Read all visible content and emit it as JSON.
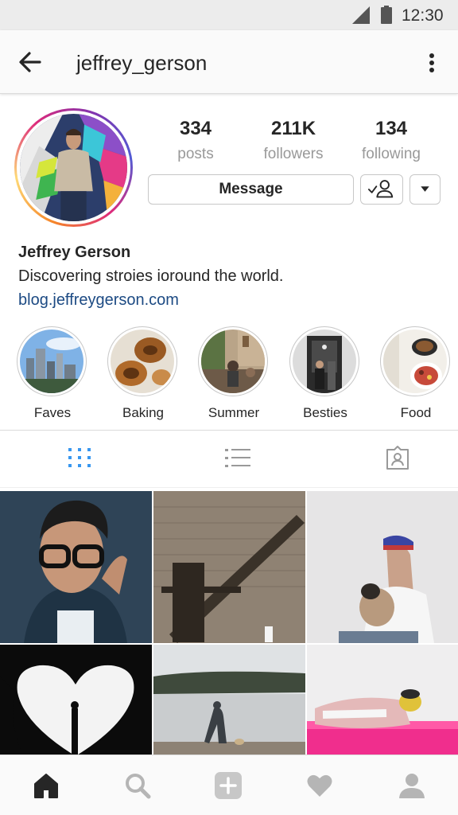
{
  "status_bar": {
    "time": "12:30",
    "icons": [
      "signal-icon",
      "battery-icon"
    ]
  },
  "header": {
    "username": "jeffrey_gerson",
    "back_icon": "arrow-left-icon",
    "menu_icon": "more-vertical-icon"
  },
  "profile": {
    "avatar_ring_colors": [
      "#f58529",
      "#dd2a7b",
      "#8134af",
      "#515bd4"
    ],
    "stats": [
      {
        "value": "334",
        "label": "posts"
      },
      {
        "value": "211K",
        "label": "followers"
      },
      {
        "value": "134",
        "label": "following"
      }
    ],
    "message_label": "Message",
    "following_icon": "person-check-icon",
    "dropdown_icon": "caret-down-icon",
    "name": "Jeffrey Gerson",
    "bio": "Discovering stroies ioround the world.",
    "website": "blog.jeffreygerson.com",
    "link_color": "#1c4a83"
  },
  "highlights": [
    {
      "label": "Faves"
    },
    {
      "label": "Baking"
    },
    {
      "label": "Summer"
    },
    {
      "label": "Besties"
    },
    {
      "label": "Food"
    }
  ],
  "tabs": [
    {
      "name": "grid-view",
      "icon": "grid-icon",
      "active": true
    },
    {
      "name": "list-view",
      "icon": "list-icon",
      "active": false
    },
    {
      "name": "tagged",
      "icon": "tagged-person-icon",
      "active": false
    }
  ],
  "accent_color": "#3897f0",
  "bottom_nav": [
    {
      "name": "home",
      "icon": "home-icon"
    },
    {
      "name": "search",
      "icon": "search-icon"
    },
    {
      "name": "add",
      "icon": "plus-square-icon"
    },
    {
      "name": "activity",
      "icon": "heart-icon"
    },
    {
      "name": "profile",
      "icon": "person-icon"
    }
  ]
}
